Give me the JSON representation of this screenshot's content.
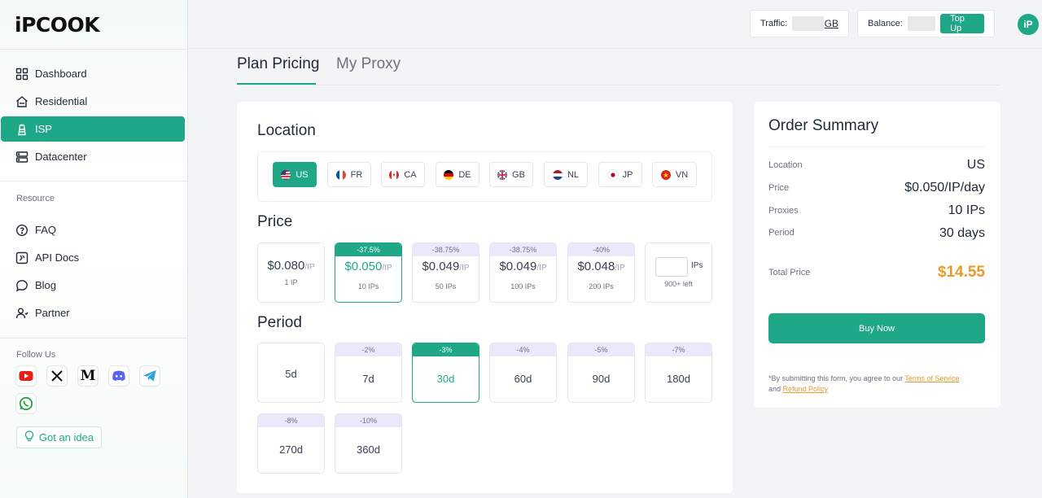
{
  "brand": {
    "logo_text": "iPCOOK"
  },
  "sidebar": {
    "nav": [
      {
        "label": "Dashboard",
        "icon": "grid-icon"
      },
      {
        "label": "Residential",
        "icon": "home-icon"
      },
      {
        "label": "ISP",
        "icon": "tower-icon"
      },
      {
        "label": "Datacenter",
        "icon": "server-icon"
      }
    ],
    "resource_heading": "Resource",
    "resources": [
      {
        "label": "FAQ",
        "icon": "question-icon"
      },
      {
        "label": "API Docs",
        "icon": "code-icon"
      },
      {
        "label": "Blog",
        "icon": "chat-icon"
      },
      {
        "label": "Partner",
        "icon": "partner-icon"
      }
    ],
    "follow_heading": "Follow Us",
    "socials": [
      "youtube-icon",
      "x-icon",
      "medium-icon",
      "discord-icon",
      "telegram-icon",
      "whatsapp-icon"
    ],
    "idea_label": "Got an idea"
  },
  "topbar": {
    "traffic_label": "Traffic:",
    "traffic_unit": "GB",
    "balance_label": "Balance:",
    "topup_label": "Top Up",
    "avatar_text": "iP"
  },
  "tabs": [
    {
      "label": "Plan Pricing",
      "active": true
    },
    {
      "label": "My Proxy",
      "active": false
    }
  ],
  "location": {
    "title": "Location",
    "options": [
      {
        "code": "US",
        "selected": true
      },
      {
        "code": "FR",
        "selected": false
      },
      {
        "code": "CA",
        "selected": false
      },
      {
        "code": "DE",
        "selected": false
      },
      {
        "code": "GB",
        "selected": false
      },
      {
        "code": "NL",
        "selected": false
      },
      {
        "code": "JP",
        "selected": false
      },
      {
        "code": "VN",
        "selected": false
      }
    ]
  },
  "price": {
    "title": "Price",
    "options": [
      {
        "badge": "",
        "price": "$0.080",
        "unit": "/IP",
        "qty": "1 IP"
      },
      {
        "badge": "-37.5%",
        "price": "$0.050",
        "unit": "/IP",
        "qty": "10 IPs",
        "selected": true
      },
      {
        "badge": "-38.75%",
        "price": "$0.049",
        "unit": "/IP",
        "qty": "50 IPs"
      },
      {
        "badge": "-38.75%",
        "price": "$0.049",
        "unit": "/IP",
        "qty": "100 IPs"
      },
      {
        "badge": "-40%",
        "price": "$0.048",
        "unit": "/IP",
        "qty": "200 IPs"
      }
    ],
    "custom": {
      "unit": "IPs",
      "left": "900+ left"
    }
  },
  "period": {
    "title": "Period",
    "options": [
      {
        "badge": "",
        "label": "5d"
      },
      {
        "badge": "-2%",
        "label": "7d"
      },
      {
        "badge": "-3%",
        "label": "30d",
        "selected": true
      },
      {
        "badge": "-4%",
        "label": "60d"
      },
      {
        "badge": "-5%",
        "label": "90d"
      },
      {
        "badge": "-7%",
        "label": "180d"
      },
      {
        "badge": "-8%",
        "label": "270d"
      },
      {
        "badge": "-10%",
        "label": "360d"
      }
    ]
  },
  "summary": {
    "title": "Order Summary",
    "rows": [
      {
        "label": "Location",
        "value": "US"
      },
      {
        "label": "Price",
        "value": "$0.050/IP/day"
      },
      {
        "label": "Proxies",
        "value": "10 IPs"
      },
      {
        "label": "Period",
        "value": "30 days"
      }
    ],
    "total_label": "Total Price",
    "total_value": "$14.55",
    "buy_label": "Buy Now",
    "legal_prefix": "*By submitting this form, you agree to our ",
    "tos_label": "Terms of Service",
    "legal_and": "and ",
    "refund_label": "Refund Policy"
  },
  "colors": {
    "accent": "#1fa888",
    "total": "#e89a2c",
    "badge_bg": "#eae8fb"
  }
}
